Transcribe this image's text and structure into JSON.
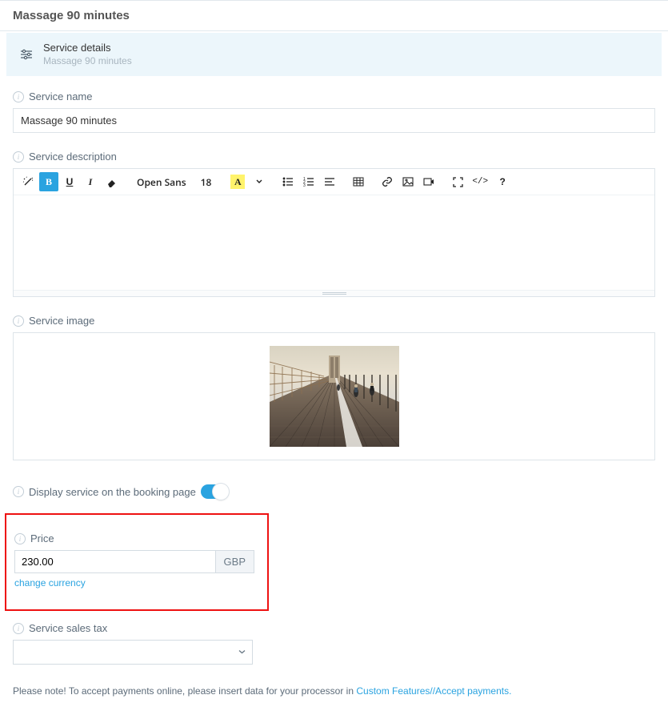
{
  "page_title": "Massage 90 minutes",
  "banner": {
    "title": "Service details",
    "subtitle": "Massage 90 minutes"
  },
  "fields": {
    "service_name": {
      "label": "Service name",
      "value": "Massage 90 minutes"
    },
    "service_description": {
      "label": "Service description"
    },
    "service_image": {
      "label": "Service image"
    },
    "display_toggle": {
      "label": "Display service on the booking page",
      "on": true
    },
    "price": {
      "label": "Price",
      "value": "230.00",
      "currency": "GBP",
      "change_link": "change currency"
    },
    "sales_tax": {
      "label": "Service sales tax"
    }
  },
  "editor_toolbar": {
    "font": "Open Sans",
    "size": "18",
    "highlight_letter": "A",
    "code_symbol": "</>",
    "help": "?"
  },
  "note": {
    "prefix": "Please note! To accept payments online, please insert data for your processor in ",
    "link": "Custom Features//Accept payments."
  }
}
